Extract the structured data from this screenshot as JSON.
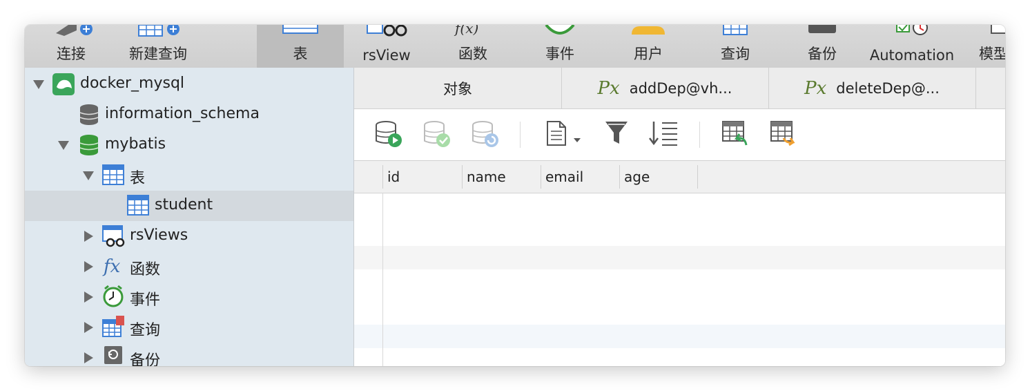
{
  "toolbar": {
    "items": [
      {
        "label": "连接",
        "icon": "connect-icon"
      },
      {
        "label": "新建查询",
        "icon": "new-query-icon"
      },
      {
        "label": "表",
        "icon": "table-icon",
        "active": true
      },
      {
        "label": "rsView",
        "icon": "view-icon"
      },
      {
        "label": "函数",
        "icon": "function-icon"
      },
      {
        "label": "事件",
        "icon": "event-icon"
      },
      {
        "label": "用户",
        "icon": "user-icon"
      },
      {
        "label": "查询",
        "icon": "query-icon"
      },
      {
        "label": "备份",
        "icon": "backup-icon"
      },
      {
        "label": "Automation",
        "icon": "automation-icon"
      },
      {
        "label": "模型",
        "icon": "model-icon"
      }
    ]
  },
  "sidebar": {
    "tree": [
      {
        "label": "docker_mysql",
        "icon": "mysql-connection-icon"
      },
      {
        "label": "information_schema",
        "icon": "database-gray-icon"
      },
      {
        "label": "mybatis",
        "icon": "database-green-icon"
      },
      {
        "label": "表",
        "icon": "table-icon"
      },
      {
        "label": "student",
        "icon": "table-icon"
      },
      {
        "label": "rsViews",
        "icon": "view-icon"
      },
      {
        "label": "函数",
        "icon": "function-icon"
      },
      {
        "label": "事件",
        "icon": "event-icon"
      },
      {
        "label": "查询",
        "icon": "query-icon"
      },
      {
        "label": "备份",
        "icon": "backup-icon"
      }
    ]
  },
  "tabs": [
    {
      "label": "对象"
    },
    {
      "label": "addDep@vh...",
      "prefix": "Px"
    },
    {
      "label": "deleteDep@...",
      "prefix": "Px"
    }
  ],
  "grid": {
    "columns": [
      "id",
      "name",
      "email",
      "age"
    ]
  },
  "colors": {
    "sidebar_bg": "#dfe8ef",
    "toolbar_bg": "#d4d4d4",
    "accent_green": "#3a9a3a",
    "function_green": "#5a7a2e"
  }
}
